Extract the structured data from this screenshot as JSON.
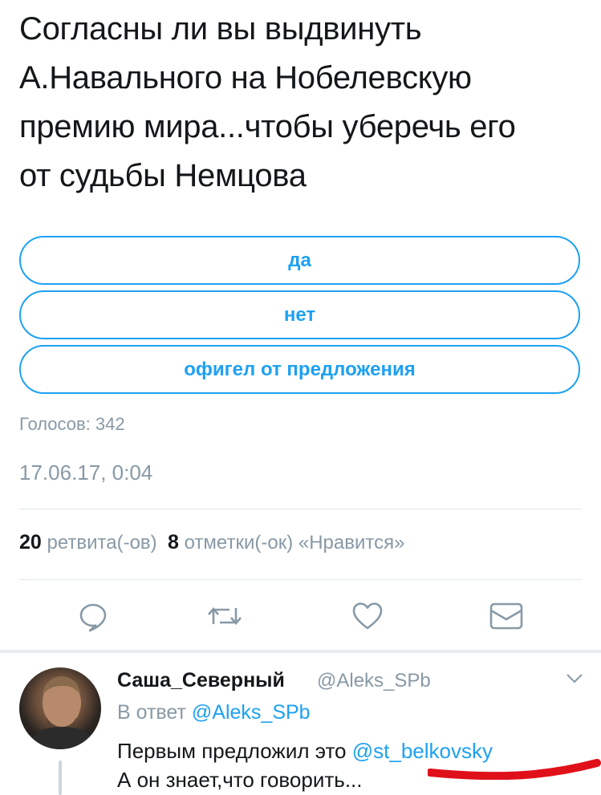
{
  "tweet": {
    "lines": [
      "Согласны ли вы выдвинуть",
      "А.Навального на Нобелевскую",
      "премию мира...чтобы уберечь его",
      "от судьбы Немцова"
    ]
  },
  "poll": {
    "options": [
      "да",
      "нет",
      "офигел от предложения"
    ],
    "votes_label": "Голосов: 342"
  },
  "timestamp": "17.06.17, 0:04",
  "stats": {
    "retweets_count": "20",
    "retweets_label": "ретвита(-ов)",
    "likes_count": "8",
    "likes_label": "отметки(-ок) «Нравится»"
  },
  "actions": [
    "reply-icon",
    "retweet-icon",
    "like-icon",
    "direct-message-icon"
  ],
  "reply": {
    "name": "Саша_Северный",
    "handle": "@Aleks_SPb",
    "in_reply_prefix": "В ответ",
    "in_reply_handle": "@Aleks_SPb",
    "text_line1": "Первым предложил это",
    "mention": "@st_belkovsky",
    "text_line2": "А он знает,что говорить..."
  },
  "colors": {
    "accent": "#1da1f2",
    "secondary_text": "#8899a6",
    "annotation_red": "#e0101b"
  }
}
